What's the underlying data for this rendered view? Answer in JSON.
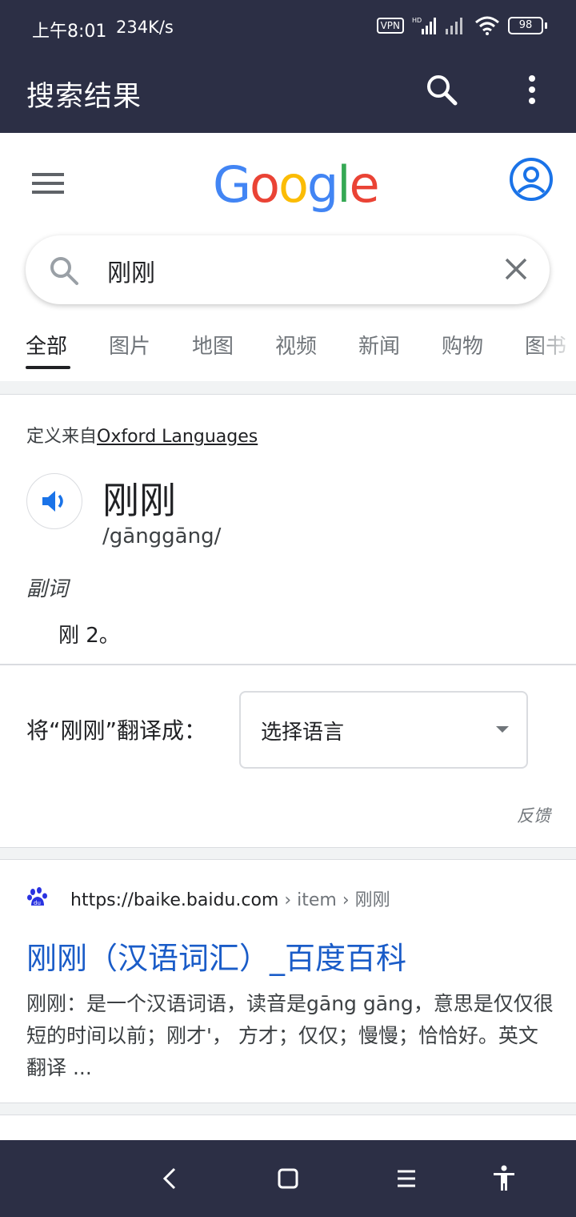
{
  "status": {
    "time": "上午8:01",
    "speed": "234K/s",
    "vpn": "VPN",
    "hd": "HD",
    "battery": "98"
  },
  "appbar": {
    "title": "搜索结果"
  },
  "google": {
    "logo_letters": [
      {
        "ch": "G",
        "color": "#4285F4"
      },
      {
        "ch": "o",
        "color": "#EA4335"
      },
      {
        "ch": "o",
        "color": "#FBBC05"
      },
      {
        "ch": "g",
        "color": "#4285F4"
      },
      {
        "ch": "l",
        "color": "#34A853"
      },
      {
        "ch": "e",
        "color": "#EA4335"
      }
    ]
  },
  "search": {
    "query": "刚刚"
  },
  "tabs": [
    {
      "label": "全部",
      "active": true
    },
    {
      "label": "图片"
    },
    {
      "label": "地图"
    },
    {
      "label": "视频"
    },
    {
      "label": "新闻"
    },
    {
      "label": "购物"
    },
    {
      "label": "图书"
    }
  ],
  "definition": {
    "source_prefix": "定义来自",
    "source_name": "Oxford Languages",
    "word": "刚刚",
    "phonetic": "/gānggāng/",
    "part_of_speech": "副词",
    "meaning": "刚 2。",
    "translate_label": "将“刚刚”翻译成：",
    "language_select": "选择语言",
    "feedback": "反馈"
  },
  "result": {
    "url": "https://baike.baidu.com",
    "crumbs": " › item › 刚刚",
    "title": "刚刚（汉语词汇）_百度百科",
    "snippet": "刚刚：是一个汉语词语，读音是gāng gāng，意思是仅仅很短的时间以前；刚才'， 方才；仅仅；慢慢；恰恰好。英文翻译 ..."
  },
  "colors": {
    "bar": "#2c2f45",
    "link": "#1a5cc8",
    "accent": "#1a73e8"
  }
}
